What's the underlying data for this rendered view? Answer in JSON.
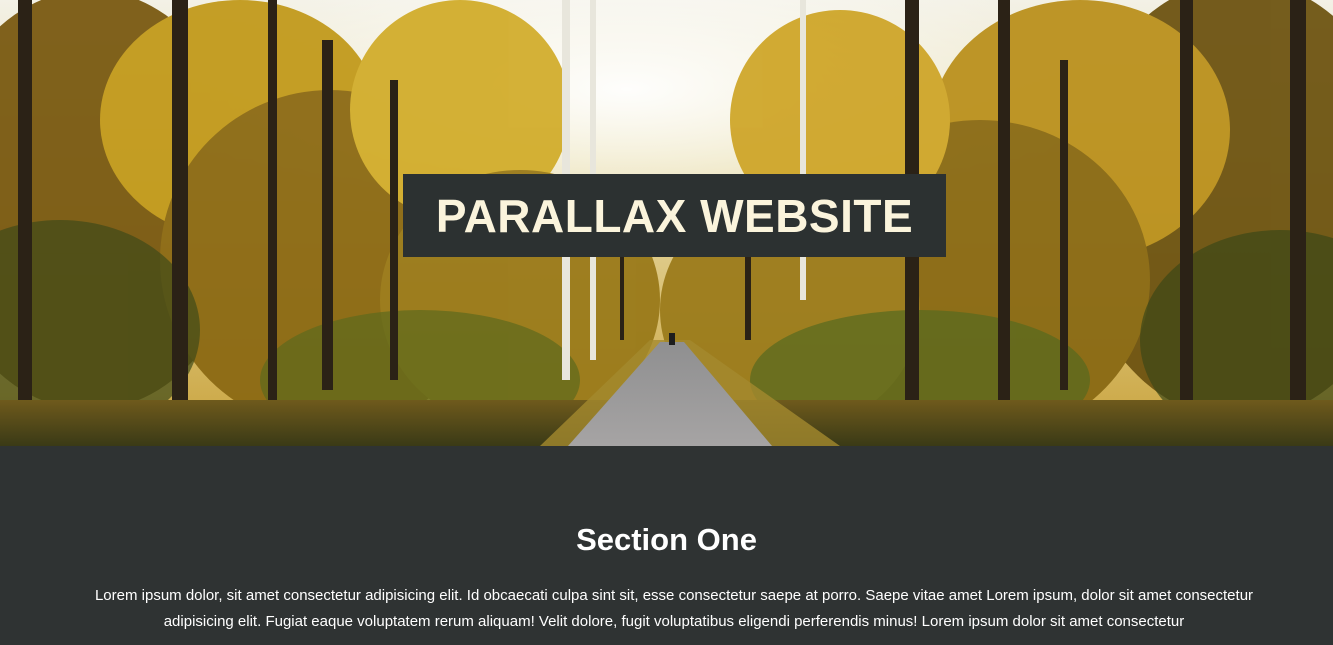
{
  "hero": {
    "title": "PARALLAX WEBSITE",
    "image": "autumn-forest-path-photo"
  },
  "section_one": {
    "title": "Section One",
    "body": "Lorem ipsum dolor, sit amet consectetur adipisicing elit. Id obcaecati culpa sint sit, esse consectetur saepe at porro. Saepe vitae amet Lorem ipsum, dolor sit amet consectetur adipisicing elit. Fugiat eaque voluptatem rerum aliquam! Velit dolore, fugit voluptatibus eligendi perferendis minus! Lorem ipsum dolor sit amet consectetur"
  },
  "colors": {
    "title_box_bg": "#2c3131",
    "title_text": "#fbf4dc",
    "section_bg": "#2f3333",
    "section_text": "#ffffff"
  }
}
